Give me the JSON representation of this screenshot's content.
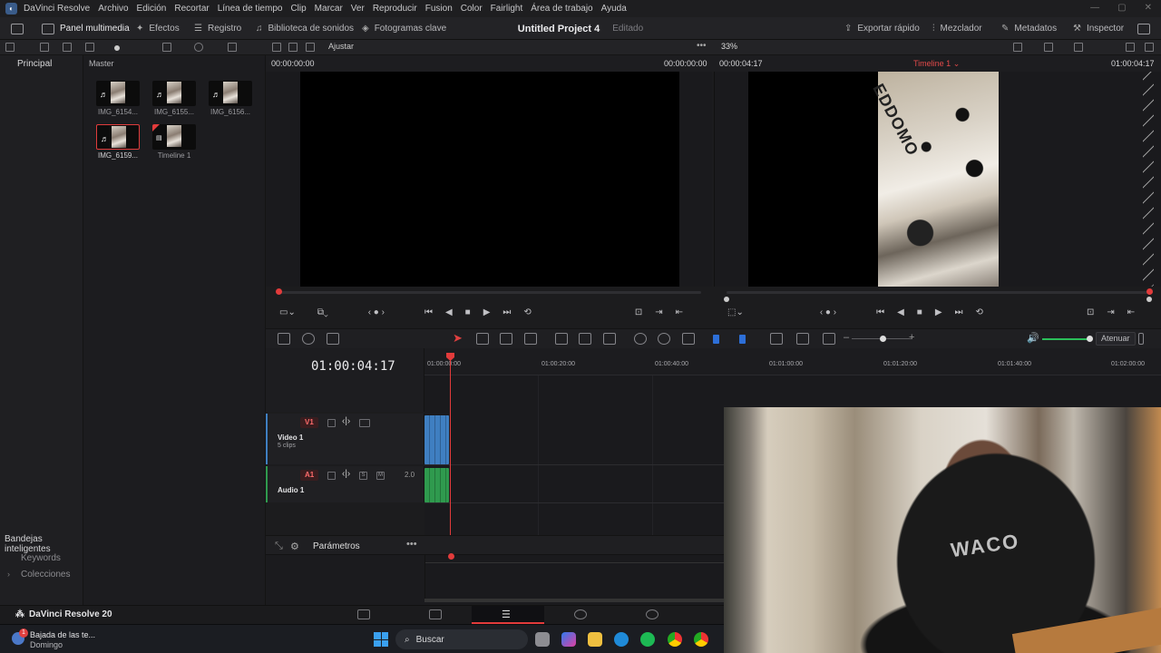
{
  "menubar": {
    "app_name": "DaVinci Resolve",
    "items": [
      "Archivo",
      "Edición",
      "Recortar",
      "Línea de tiempo",
      "Clip",
      "Marcar",
      "Ver",
      "Reproducir",
      "Fusion",
      "Color",
      "Fairlight",
      "Área de trabajo",
      "Ayuda"
    ]
  },
  "toolbar": {
    "media_pool": "Panel multimedia",
    "effects": "Efectos",
    "index": "Registro",
    "sound_library": "Biblioteca de sonidos",
    "keyframes": "Fotogramas clave",
    "quick_export": "Exportar rápido",
    "mixer": "Mezclador",
    "metadata": "Metadatos",
    "inspector": "Inspector"
  },
  "project": {
    "title": "Untitled Project 4",
    "status": "Editado"
  },
  "toolbar2": {
    "fit": "Ajustar",
    "zoom": "33%"
  },
  "sidebar": {
    "header": "Principal",
    "smart_bins": "Bandejas inteligentes",
    "keywords": "Keywords",
    "collections": "Colecciones"
  },
  "media_pool": {
    "bin": "Master",
    "clips": [
      {
        "label": "IMG_6154...",
        "type": "audio-video",
        "selected": false
      },
      {
        "label": "IMG_6155...",
        "type": "audio-video",
        "selected": false
      },
      {
        "label": "IMG_6156...",
        "type": "audio-video",
        "selected": false
      },
      {
        "label": "IMG_6159...",
        "type": "audio-video",
        "selected": true
      },
      {
        "label": "Timeline 1",
        "type": "timeline",
        "selected": false
      }
    ]
  },
  "viewer": {
    "source_tc_left": "00:00:00:00",
    "source_tc_right": "00:00:00:00",
    "timeline_tc_left": "00:00:04:17",
    "timeline_name": "Timeline 1",
    "timeline_tc_right": "01:00:04:17",
    "frame_text": "EDDOMO"
  },
  "audio": {
    "mute_label": "Atenuar"
  },
  "timeline": {
    "timecode": "01:00:04:17",
    "ruler": [
      "01:00:00:00",
      "01:00:20:00",
      "01:00:40:00",
      "01:01:00:00",
      "01:01:20:00",
      "01:01:40:00",
      "01:02:00:00"
    ],
    "tracks": [
      {
        "id": "V1",
        "name": "Video 1",
        "sub": "5 clips",
        "color": "#3f7fc1"
      },
      {
        "id": "A1",
        "name": "Audio 1",
        "level": "2.0",
        "color": "#2f9a4e"
      }
    ],
    "solo": "S",
    "mute": "M"
  },
  "params": {
    "label": "Parámetros"
  },
  "pagebar": {
    "brand": "DaVinci Resolve 20",
    "active_page": "edit"
  },
  "taskbar": {
    "weather_title": "Bajada de las te...",
    "weather_sub": "Domingo",
    "search_placeholder": "Buscar",
    "notification_count": "1"
  },
  "webcam": {
    "shirt_text": "WACO"
  },
  "colors": {
    "accent_red": "#e23b3b",
    "video_clip": "#3f7fc1",
    "audio_clip": "#2f9a4e",
    "volume": "#2bbf5a"
  }
}
